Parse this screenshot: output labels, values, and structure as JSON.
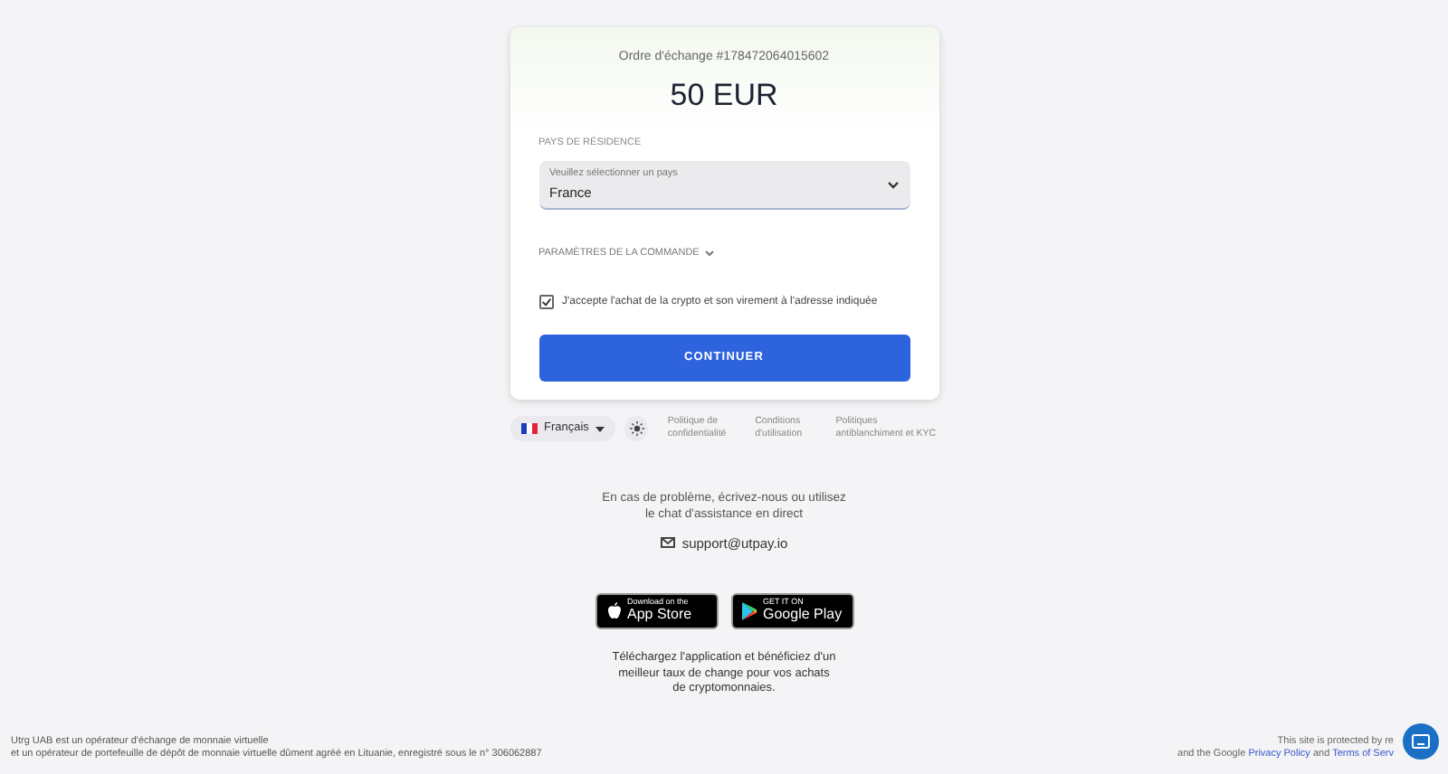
{
  "order": {
    "label": "Ordre d'échange #178472064015602",
    "amount": "50 EUR"
  },
  "country": {
    "section_label": "PAYS DE RÉSIDENCE",
    "placeholder": "Veuillez sélectionner un pays",
    "value": "France"
  },
  "settings": {
    "label": "PARAMÈTRES DE LA COMMANDE",
    "expanded": false
  },
  "consent": {
    "label": "J'accepte l'achat de la crypto et son virement à l'adresse indiquée",
    "checked": true
  },
  "submit": "CONTINUER",
  "language": "Français",
  "links": [
    "Politique de confidentialité",
    "Conditions d'utilisation",
    "Politiques antiblanchiment et KYC"
  ],
  "support": {
    "text": "En cas de problème, écrivez-nous ou utilisez le chat d'assistance en direct",
    "email": "support@utpay.io"
  },
  "stores": [
    {
      "kind": "apple",
      "small": "Download on the",
      "big": "App Store"
    },
    {
      "kind": "google",
      "small": "GET IT ON",
      "big": "Google Play"
    }
  ],
  "app_text": "Téléchargez l'application et bénéficiez d'un meilleur taux de change pour vos achats de cryptomonnaies.",
  "legal": [
    "Utrg UAB est un opérateur d'échange de monnaie virtuelle",
    "et un opérateur de portefeuille de dépôt de monnaie virtuelle dûment agréé en Lituanie, enregistré sous le n° 306062887"
  ],
  "recaptcha": {
    "line1": "This site is protected by re",
    "prefix": "and the Google",
    "privacy": "Privacy Policy",
    "and": "and",
    "terms": "Terms of Serv"
  }
}
